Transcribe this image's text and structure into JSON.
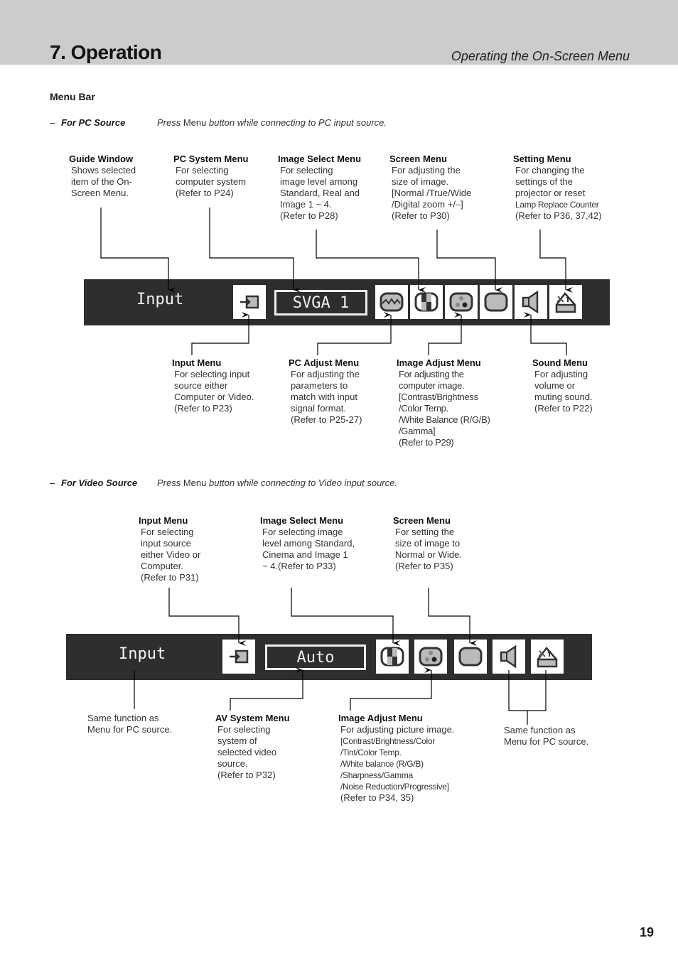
{
  "header": {
    "chapter": "7. Operation",
    "section": "Operating the On-Screen Menu"
  },
  "menu_bar_heading": "Menu Bar",
  "pc_source": {
    "dash": "–",
    "label": "For PC Source",
    "instruction_prefix": "Press ",
    "instruction_bold": "Menu",
    "instruction_suffix": " button  while connecting to PC input source.",
    "bar": {
      "guide_text": "Input",
      "system_text": "SVGA 1",
      "icons": [
        "input-icon",
        "pc-adjust-icon",
        "image-select-icon",
        "image-adjust-icon",
        "screen-icon",
        "sound-icon",
        "setting-icon"
      ]
    },
    "top_callouts": [
      {
        "title": "Guide Window",
        "body": "Shows selected\nitem of the On-\nScreen Menu."
      },
      {
        "title": "PC System Menu",
        "body": "For selecting\ncomputer system\n(Refer to P24)"
      },
      {
        "title": "Image Select Menu",
        "body": "For selecting\nimage level among\nStandard, Real and\nImage 1 ~ 4.\n(Refer to P28)"
      },
      {
        "title": "Screen Menu",
        "body": "For adjusting the\nsize of image.\n[Normal /True/Wide\n/Digital zoom +/–]\n(Refer to P30)"
      },
      {
        "title": "Setting Menu",
        "body_lines": [
          "For changing the",
          "settings of the",
          "projector or reset",
          "Lamp Replace Counter",
          "(Refer to P36, 37,42)"
        ]
      }
    ],
    "bottom_callouts": [
      {
        "title": "Input Menu",
        "body": "For selecting input\nsource either\nComputer or Video.\n(Refer to P23)"
      },
      {
        "title": "PC Adjust Menu",
        "body": "For adjusting the\nparameters to\nmatch with input\nsignal format.\n(Refer to P25-27)"
      },
      {
        "title": "Image  Adjust Menu",
        "body": "For adjusting the\ncomputer image.\n[Contrast/Brightness\n /Color Temp.\n /White Balance (R/G/B)\n /Gamma]\n(Refer to P29)"
      },
      {
        "title": "Sound Menu",
        "body": "For adjusting\nvolume or\nmuting sound.\n(Refer to P22)"
      }
    ]
  },
  "video_source": {
    "dash": "–",
    "label": "For Video Source",
    "instruction_prefix": "Press ",
    "instruction_bold": "Menu",
    "instruction_suffix": " button while connecting to Video input source.",
    "bar": {
      "guide_text": "Input",
      "system_text": "Auto",
      "icons": [
        "input-icon",
        "image-select-icon",
        "image-adjust-icon",
        "screen-icon",
        "sound-icon",
        "setting-icon"
      ]
    },
    "top_callouts": [
      {
        "title": "Input Menu",
        "body": "For selecting\ninput source\neither Video or\nComputer.\n(Refer to P31)"
      },
      {
        "title": "Image Select Menu",
        "body": "For selecting image\nlevel among Standard,\nCinema and Image 1\n~ 4.(Refer to P33)"
      },
      {
        "title": "Screen Menu",
        "body": "For setting the\nsize of image to\nNormal or Wide.\n(Refer to P35)"
      }
    ],
    "bottom_callouts": [
      {
        "title": "",
        "body": "Same function as\nMenu for PC source."
      },
      {
        "title": "AV System Menu",
        "body": "For selecting\nsystem of\nselected video\nsource.\n(Refer to P32)"
      },
      {
        "title": "Image Adjust Menu",
        "body_lines": [
          "For adjusting picture image.",
          "[Contrast/Brightness/Color",
          " /Tint/Color Temp.",
          " /White balance (R/G/B)",
          " /Sharpness/Gamma",
          " /Noise Reduction/Progressive]",
          "(Refer to P34, 35)"
        ]
      },
      {
        "title": "",
        "body": "Same function as\nMenu for PC source."
      }
    ]
  },
  "page_number": "19"
}
